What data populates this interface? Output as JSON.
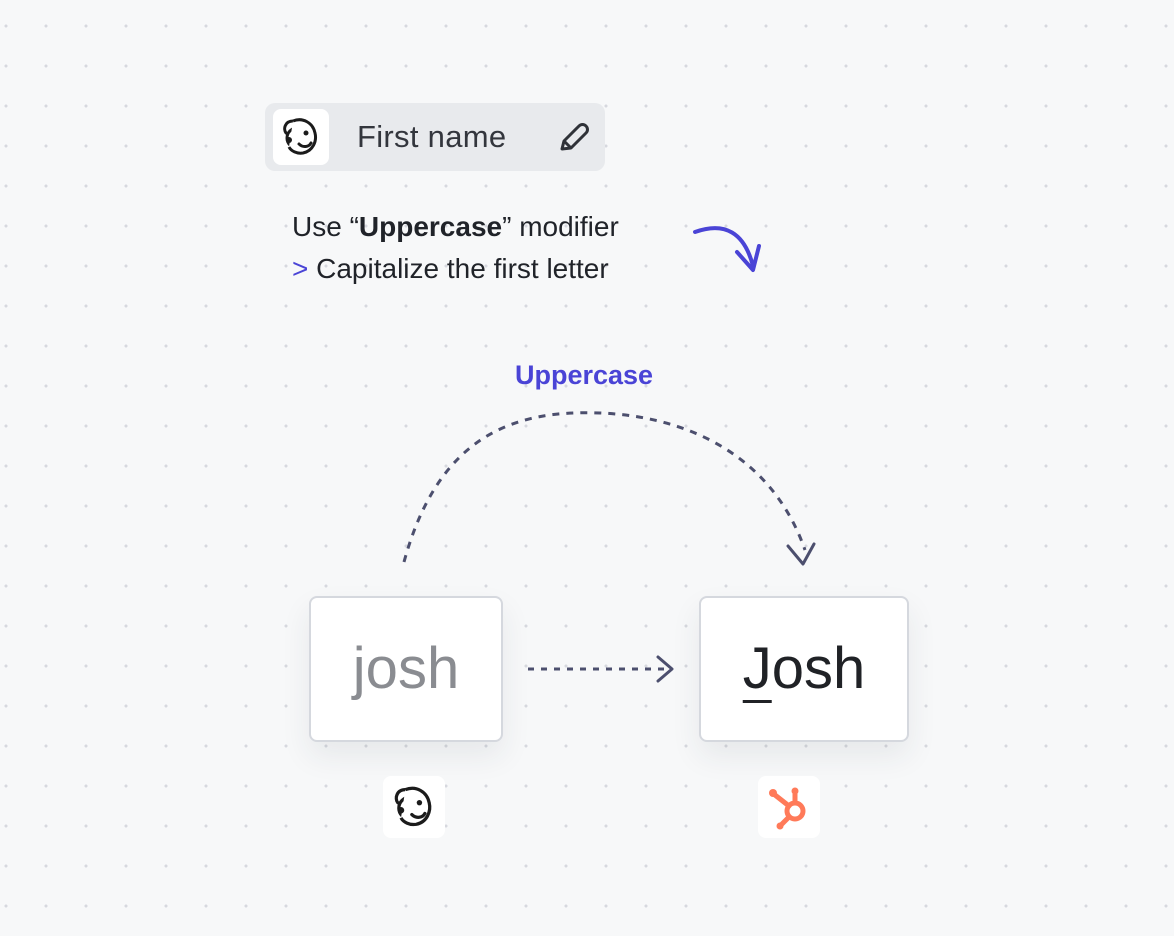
{
  "field": {
    "label": "First name",
    "app_icon": "mailchimp-icon",
    "edit_icon": "pencil-icon"
  },
  "instructions": {
    "prefix": "Use ",
    "open_quote": "“",
    "modifier": "Uppercase",
    "close_quote": "”",
    "suffix": " modifier",
    "bullet": ">",
    "detail": "Capitalize the first letter"
  },
  "transform": {
    "label": "Uppercase",
    "accent_color": "#4a44d6"
  },
  "source": {
    "value": "josh",
    "app_icon": "mailchimp-icon"
  },
  "target": {
    "first_letter": "J",
    "rest": "osh",
    "app_icon": "hubspot-icon"
  }
}
